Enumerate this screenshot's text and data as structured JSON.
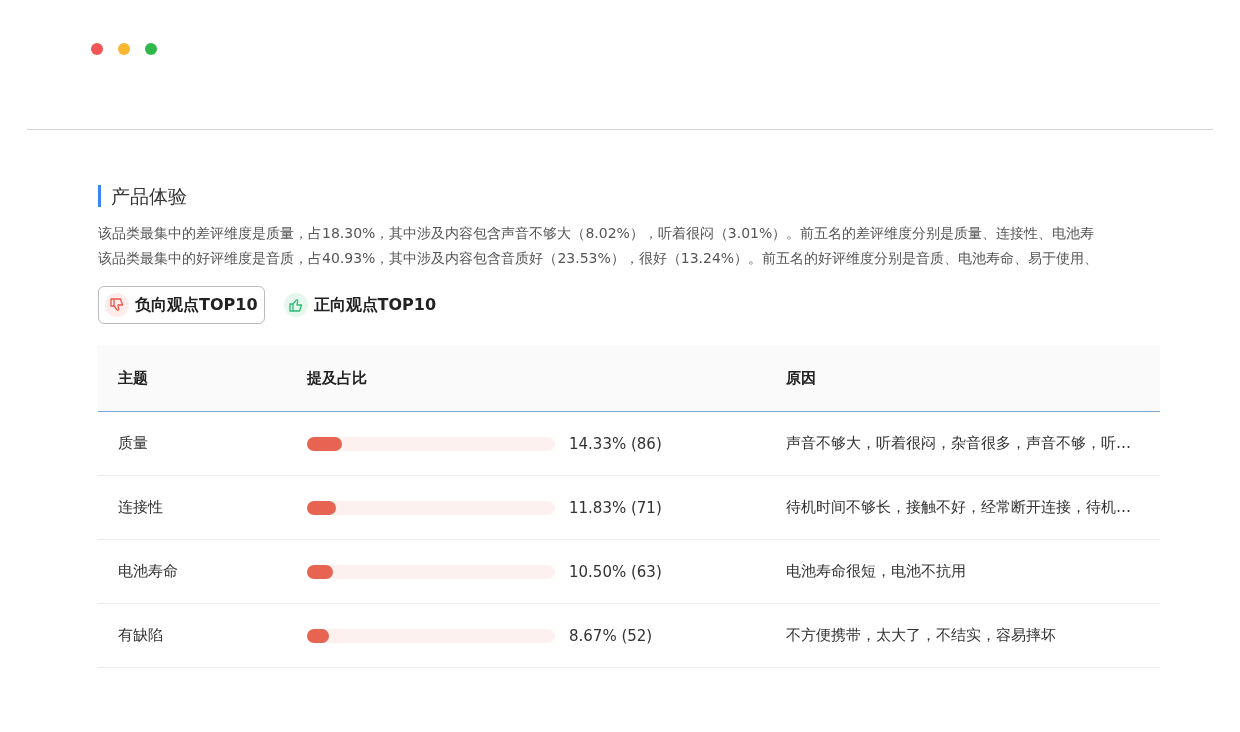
{
  "section": {
    "title": "产品体验",
    "summary": [
      "该品类最集中的差评维度是质量，占18.30%，其中涉及内容包含声音不够大（8.02%），听着很闷（3.01%）。前五名的差评维度分别是质量、连接性、电池寿",
      "该品类最集中的好评维度是音质，占40.93%，其中涉及内容包含音质好（23.53%），很好（13.24%）。前五名的好评维度分别是音质、电池寿命、易于使用、"
    ]
  },
  "tabs": [
    {
      "label": "负向观点TOP10",
      "kind": "negative",
      "selected": true
    },
    {
      "label": "正向观点TOP10",
      "kind": "positive",
      "selected": false
    }
  ],
  "table": {
    "columns": [
      "主题",
      "提及占比",
      "原因"
    ],
    "rows": [
      {
        "topic": "质量",
        "level": 0.143,
        "reading": "14.33% (86)",
        "reason": "声音不够大，听着很闷，杂音很多，声音不够，听…"
      },
      {
        "topic": "连接性",
        "level": 0.118,
        "reading": "11.83% (71)",
        "reason": "待机时间不够长，接触不好，经常断开连接，待机…"
      },
      {
        "topic": "电池寿命",
        "level": 0.105,
        "reading": "10.50% (63)",
        "reason": "电池寿命很短，电池不抗用"
      },
      {
        "topic": "有缺陷",
        "level": 0.087,
        "reading": "8.67% (52)",
        "reason": "不方便携带，太大了，不结实，容易摔坏"
      }
    ]
  }
}
